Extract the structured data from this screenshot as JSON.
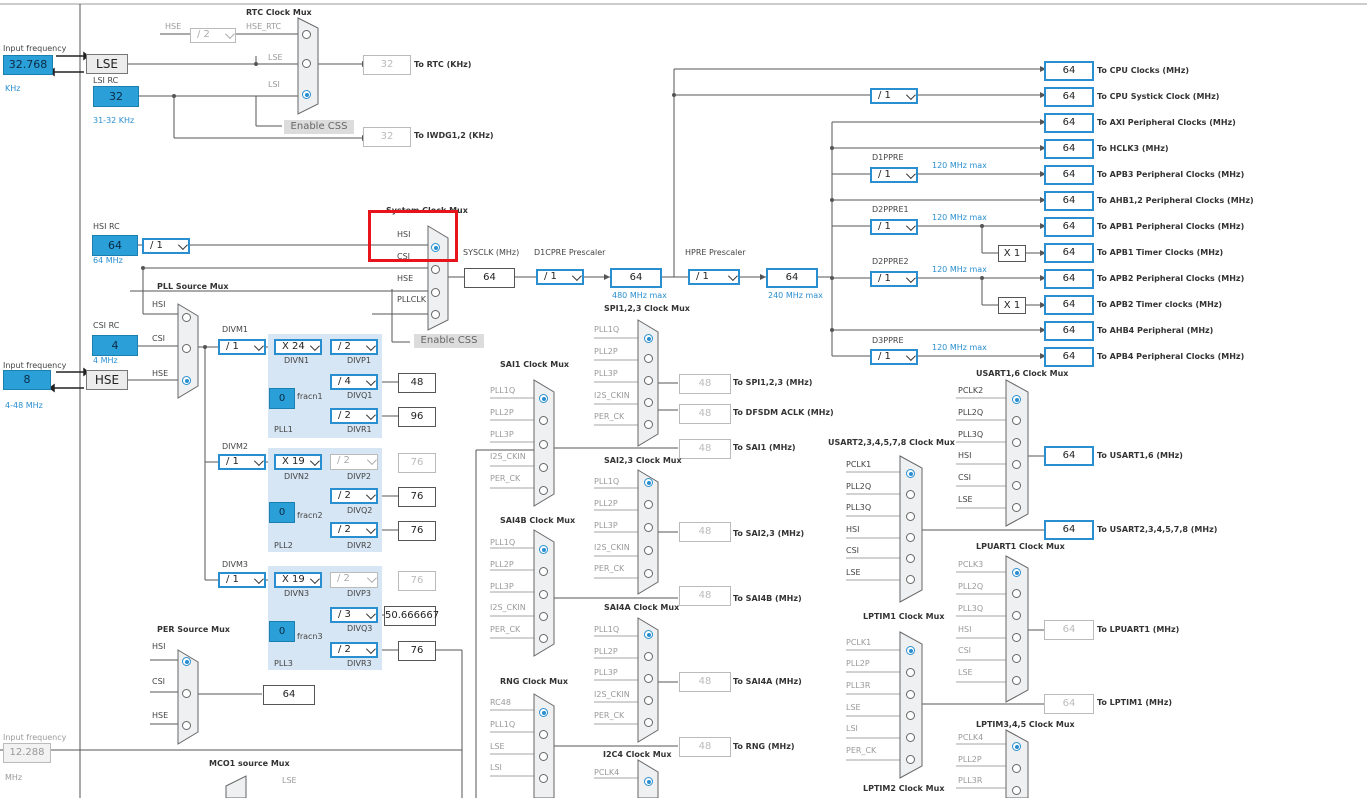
{
  "inputs": {
    "lse_label": "Input frequency",
    "lse_value": "32.768",
    "lse_unit": "KHz",
    "hse_label": "Input frequency",
    "hse_value": "8",
    "hse_range": "4-48 MHz",
    "ext_label": "Input frequency",
    "ext_value": "12.288",
    "ext_unit": "MHz"
  },
  "oscillators": {
    "lse": "LSE",
    "hse": "HSE",
    "lsirc_label": "LSI RC",
    "lsirc_value": "32",
    "lsirc_range": "31-32 KHz",
    "hsirc_label": "HSI RC",
    "hsirc_value": "64",
    "hsirc_freq": "64 MHz",
    "csirc_label": "CSI RC",
    "csirc_value": "4",
    "csirc_freq": "4 MHz"
  },
  "rtc": {
    "title": "RTC Clock Mux",
    "hse": "HSE",
    "div": "/ 2",
    "hse_rtc": "HSE_RTC",
    "lse": "LSE",
    "lsi": "LSI",
    "enable_css": "Enable CSS",
    "rtc_value": "32",
    "rtc_label": "To RTC (KHz)",
    "iwdg_value": "32",
    "iwdg_label": "To IWDG1,2 (KHz)"
  },
  "sysmux": {
    "title": "System Clock Mux",
    "hsi": "HSI",
    "csi": "CSI",
    "hse": "HSE",
    "pllclk": "PLLCLK",
    "enable_css": "Enable CSS",
    "hsi_div": "/ 1",
    "sysclk_label": "SYSCLK (MHz)",
    "sysclk_value": "64"
  },
  "prescalers": {
    "d1cpre_label": "D1CPRE Prescaler",
    "d1cpre": "/ 1",
    "d1cpre_out": "64",
    "d1cpre_max": "480 MHz max",
    "hpre_label": "HPRE Prescaler",
    "hpre": "/ 1",
    "hpre_out": "64",
    "hpre_max": "240 MHz max",
    "systick_div": "/ 1",
    "d1ppre_label": "D1PPRE",
    "d1ppre": "/ 1",
    "d1ppre_max": "120 MHz max",
    "d2ppre1_label": "D2PPRE1",
    "d2ppre1": "/ 1",
    "d2ppre1_max": "120 MHz max",
    "d2ppre2_label": "D2PPRE2",
    "d2ppre2": "/ 1",
    "d2ppre2_max": "120 MHz max",
    "d3ppre_label": "D3PPRE",
    "d3ppre": "/ 1",
    "d3ppre_max": "120 MHz max",
    "x1_a": "X 1",
    "x1_b": "X 1"
  },
  "outputs": [
    {
      "value": "64",
      "label": "To CPU Clocks (MHz)"
    },
    {
      "value": "64",
      "label": "To CPU Systick Clock (MHz)"
    },
    {
      "value": "64",
      "label": "To AXI Peripheral Clocks (MHz)"
    },
    {
      "value": "64",
      "label": "To HCLK3 (MHz)"
    },
    {
      "value": "64",
      "label": "To APB3 Peripheral Clocks (MHz)"
    },
    {
      "value": "64",
      "label": "To AHB1,2 Peripheral Clocks (MHz)"
    },
    {
      "value": "64",
      "label": "To APB1 Peripheral Clocks (MHz)"
    },
    {
      "value": "64",
      "label": "To APB1 Timer Clocks (MHz)"
    },
    {
      "value": "64",
      "label": "To APB2 Peripheral Clocks (MHz)"
    },
    {
      "value": "64",
      "label": "To APB2 Timer clocks (MHz)"
    },
    {
      "value": "64",
      "label": "To AHB4 Peripheral (MHz)"
    },
    {
      "value": "64",
      "label": "To APB4 Peripheral Clocks (MHz)"
    }
  ],
  "pll": {
    "source_title": "PLL Source Mux",
    "hsi": "HSI",
    "csi": "CSI",
    "hse": "HSE",
    "pll1": {
      "divm_label": "DIVM1",
      "divm": "/ 1",
      "divn": "X 24",
      "divn_label": "DIVN1",
      "divp": "/ 2",
      "divp_label": "DIVP1",
      "divq": "/ 4",
      "divq_label": "DIVQ1",
      "divq_out": "48",
      "divr": "/ 2",
      "divr_label": "DIVR1",
      "divr_out": "96",
      "frac": "0",
      "frac_label": "fracn1",
      "name": "PLL1"
    },
    "pll2": {
      "divm_label": "DIVM2",
      "divm": "/ 1",
      "divn": "X 19",
      "divn_label": "DIVN2",
      "divp": "/ 2",
      "divp_label": "DIVP2",
      "divp_out": "76",
      "divq": "/ 2",
      "divq_label": "DIVQ2",
      "divq_out": "76",
      "divr": "/ 2",
      "divr_label": "DIVR2",
      "divr_out": "76",
      "frac": "0",
      "frac_label": "fracn2",
      "name": "PLL2"
    },
    "pll3": {
      "divm_label": "DIVM3",
      "divm": "/ 1",
      "divn": "X 19",
      "divn_label": "DIVN3",
      "divp": "/ 2",
      "divp_label": "DIVP3",
      "divp_out": "76",
      "divq": "/ 3",
      "divq_label": "DIVQ3",
      "divq_out": "50.666667",
      "divr": "/ 2",
      "divr_label": "DIVR3",
      "divr_out": "76",
      "frac": "0",
      "frac_label": "fracn3",
      "name": "PLL3"
    }
  },
  "per": {
    "title": "PER Source Mux",
    "hsi": "HSI",
    "csi": "CSI",
    "hse": "HSE",
    "out": "64"
  },
  "mco1": {
    "title": "MCO1 source Mux",
    "lse": "LSE"
  },
  "spi123": {
    "title": "SPI1,2,3 Clock Mux",
    "in": [
      "PLL1Q",
      "PLL2P",
      "PLL3P",
      "I2S_CKIN",
      "PER_CK"
    ],
    "out": "48",
    "label": "To SPI1,2,3 (MHz)",
    "dfsdm_out": "48",
    "dfsdm_label": "To DFSDM ACLK (MHz)"
  },
  "sai1": {
    "title": "SAI1 Clock Mux",
    "in": [
      "PLL1Q",
      "PLL2P",
      "PLL3P",
      "I2S_CKIN",
      "PER_CK"
    ],
    "out": "48",
    "label": "To SAI1 (MHz)"
  },
  "sai23": {
    "title": "SAI2,3 Clock Mux",
    "in": [
      "PLL1Q",
      "PLL2P",
      "PLL3P",
      "I2S_CKIN",
      "PER_CK"
    ],
    "out": "48",
    "label": "To SAI2,3 (MHz)"
  },
  "sai4b": {
    "title": "SAI4B Clock Mux",
    "in": [
      "PLL1Q",
      "PLL2P",
      "PLL3P",
      "I2S_CKIN",
      "PER_CK"
    ],
    "out": "48",
    "label": "To SAI4B (MHz)"
  },
  "sai4a": {
    "title": "SAI4A Clock Mux",
    "in": [
      "PLL1Q",
      "PLL2P",
      "PLL3P",
      "I2S_CKIN",
      "PER_CK"
    ],
    "out": "48",
    "label": "To SAI4A (MHz)"
  },
  "rng": {
    "title": "RNG Clock Mux",
    "in": [
      "RC48",
      "PLL1Q",
      "LSE",
      "LSI"
    ],
    "out": "48",
    "label": "To RNG (MHz)"
  },
  "i2c4": {
    "title": "I2C4 Clock Mux",
    "in": [
      "PCLK4"
    ]
  },
  "usart16": {
    "title": "USART1,6 Clock Mux",
    "in": [
      "PCLK2",
      "PLL2Q",
      "PLL3Q",
      "HSI",
      "CSI",
      "LSE"
    ],
    "out": "64",
    "label": "To USART1,6 (MHz)"
  },
  "usart2345": {
    "title": "USART2,3,4,5,7,8 Clock Mux",
    "in": [
      "PCLK1",
      "PLL2Q",
      "PLL3Q",
      "HSI",
      "CSI",
      "LSE"
    ],
    "out": "64",
    "label": "To USART2,3,4,5,7,8 (MHz)"
  },
  "lpuart1": {
    "title": "LPUART1 Clock Mux",
    "in": [
      "PCLK3",
      "PLL2Q",
      "PLL3Q",
      "HSI",
      "CSI",
      "LSE"
    ],
    "out": "64",
    "label": "To LPUART1 (MHz)"
  },
  "lptim1": {
    "title": "LPTIM1 Clock Mux",
    "in": [
      "PCLK1",
      "PLL2P",
      "PLL3R",
      "LSE",
      "LSI",
      "PER_CK"
    ],
    "out": "64",
    "label": "To LPTIM1 (MHz)"
  },
  "lptim345": {
    "title": "LPTIM3,4,5 Clock Mux",
    "in": [
      "PCLK4",
      "PLL2P",
      "PLL3R"
    ]
  },
  "lptim2": {
    "title": "LPTIM2 Clock Mux"
  }
}
